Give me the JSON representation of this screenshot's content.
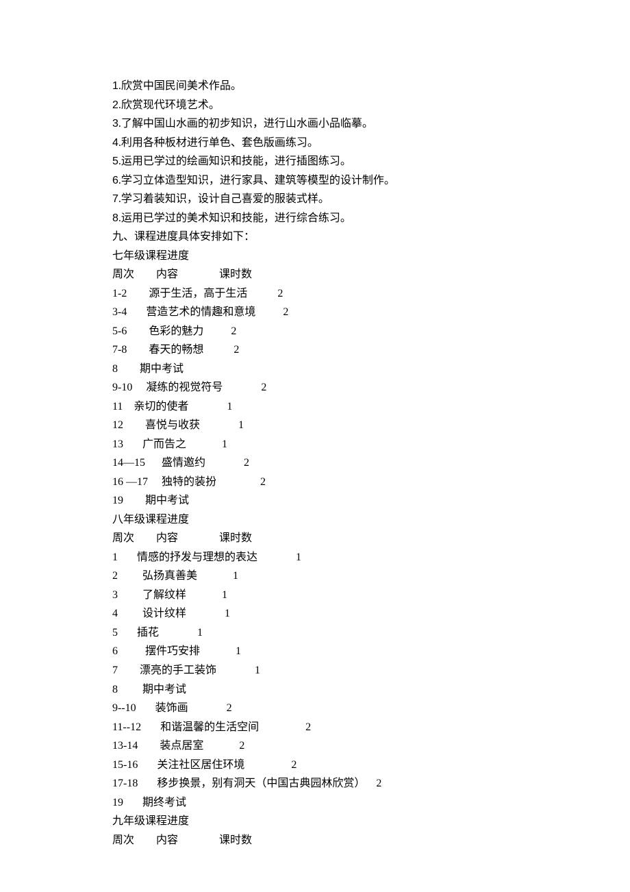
{
  "items": [
    {
      "no": "1",
      "text": "欣赏中国民间美术作品。"
    },
    {
      "no": "2",
      "text": "欣赏现代环境艺术。"
    },
    {
      "no": "3",
      "text": "了解中国山水画的初步知识，进行山水画小品临摹。"
    },
    {
      "no": "4",
      "text": "利用各种板材进行单色、套色版画练习。"
    },
    {
      "no": "5",
      "text": "运用已学过的绘画知识和技能，进行插图练习。"
    },
    {
      "no": "6",
      "text": "学习立体造型知识，进行家具、建筑等模型的设计制作。"
    },
    {
      "no": "7",
      "text": "学习着装知识，设计自己喜爱的服装式样。"
    },
    {
      "no": "8",
      "text": "运用已学过的美术知识和技能，进行综合练习。"
    }
  ],
  "sectionNine": "九、课程进度具体安排如下：",
  "header": "周次        内容               课时数",
  "grade7": {
    "title": "七年级课程进度",
    "rows": [
      "1-2        源于生活，高于生活           2",
      "3-4       营造艺术的情趣和意境          2",
      "5-6        色彩的魅力          2",
      "7-8        春天的畅想           2",
      "8        期中考试",
      "9-10     凝练的视觉符号              2",
      "11    亲切的使者              1",
      "12        喜悦与收获              1",
      "13       广而告之             1",
      "14—15      盛情邀约              2",
      "16 —17     独特的装扮                2",
      "19        期中考试"
    ]
  },
  "grade8": {
    "title": "八年级课程进度",
    "rows": [
      "1       情感的抒发与理想的表达              1",
      "2         弘扬真善美             1",
      "3         了解纹样             1",
      "4         设计纹样              1",
      "5       插花              1",
      "6          摆件巧安排             1",
      "7        漂亮的手工装饰              1",
      "8         期中考试",
      "9--10       装饰画              2",
      "11--12       和谐温馨的生活空间                 2",
      "13-14        装点居室             2",
      "15-16       关注社区居住环境                 2",
      "17-18       移步换景，别有洞天（中国古典园林欣赏）    2",
      "19       期终考试"
    ]
  },
  "grade9": {
    "title": "九年级课程进度"
  }
}
